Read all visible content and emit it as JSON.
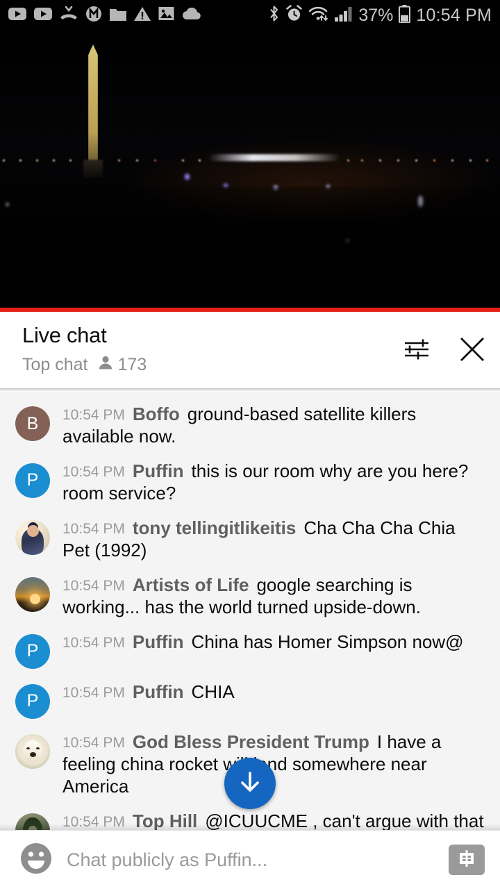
{
  "statusbar": {
    "icons_left": [
      "youtube-icon",
      "youtube-icon",
      "missed-call-icon",
      "circled-m-icon",
      "folder-icon",
      "warning-triangle-icon",
      "image-icon",
      "cloud-icon"
    ],
    "icons_right": [
      "bluetooth-icon",
      "alarm-icon",
      "wifi-icon",
      "signal-icon",
      "battery-icon"
    ],
    "battery_percent": "37%",
    "time": "10:54 PM"
  },
  "video": {
    "description": "Washington Monument night live stream",
    "progress_color": "#e62117",
    "progress_percent": 100
  },
  "chat_header": {
    "title": "Live chat",
    "mode": "Top chat",
    "viewer_count": "173",
    "settings_icon": "sliders-icon",
    "close_icon": "close-icon"
  },
  "messages": [
    {
      "time": "10:54 PM",
      "author": "Boffo",
      "text": "ground-based satellite killers available now.",
      "avatar_type": "initial",
      "avatar_initial": "B",
      "avatar_color": "#846157"
    },
    {
      "time": "10:54 PM",
      "author": "Puffin",
      "text": "this is our room why are you here? room service?",
      "avatar_type": "initial",
      "avatar_initial": "P",
      "avatar_color": "#1a8ed1"
    },
    {
      "time": "10:54 PM",
      "author": "tony tellingitlikeitis",
      "text": "Cha Cha Cha Chia Pet (1992)",
      "avatar_type": "photo",
      "avatar_photo": "av-tony"
    },
    {
      "time": "10:54 PM",
      "author": "Artists of Life",
      "text": "google searching is working... has the world turned upside-down.",
      "avatar_type": "photo",
      "avatar_photo": "av-sunset"
    },
    {
      "time": "10:54 PM",
      "author": "Puffin",
      "text": "China has Homer Simpson now@",
      "avatar_type": "initial",
      "avatar_initial": "P",
      "avatar_color": "#1a8ed1"
    },
    {
      "time": "10:54 PM",
      "author": "Puffin",
      "text": "CHIA",
      "avatar_type": "initial",
      "avatar_initial": "P",
      "avatar_color": "#1a8ed1"
    },
    {
      "time": "10:54 PM",
      "author": "God Bless President Trump",
      "text": "I have a feeling china rocket will land somewhere near America",
      "avatar_type": "photo",
      "avatar_photo": "av-dog"
    },
    {
      "time": "10:54 PM",
      "author": "Top Hill",
      "text": "@ICUUCME , can't argue with that",
      "avatar_type": "photo",
      "avatar_photo": "av-tophill"
    }
  ],
  "scroll_button": {
    "icon": "arrow-down-icon",
    "color": "#1566c0"
  },
  "composer": {
    "emoji_icon": "emoji-smiley-icon",
    "placeholder": "Chat publicly as Puffin...",
    "value": "",
    "superchat_icon": "dollar-bill-icon"
  }
}
